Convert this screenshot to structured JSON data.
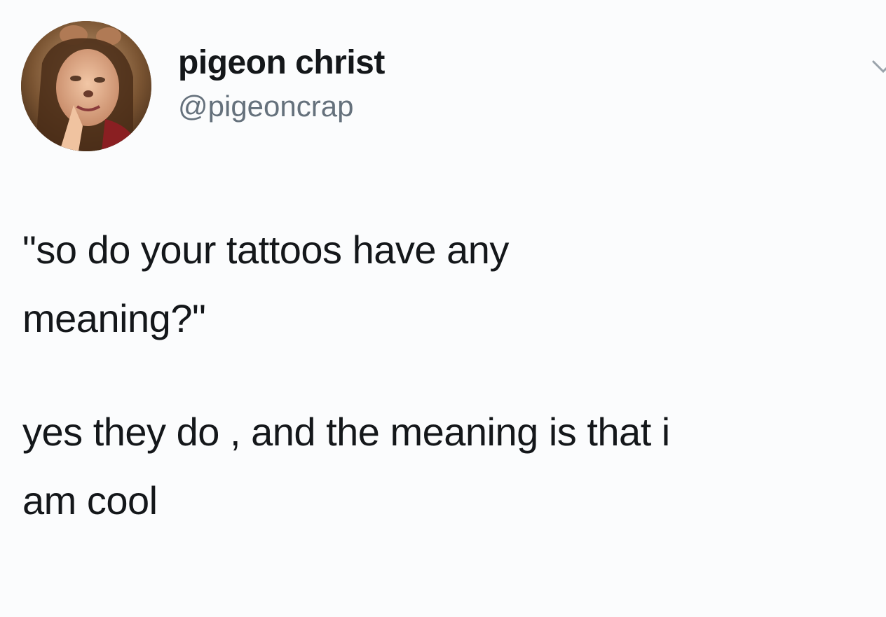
{
  "tweet": {
    "author": {
      "display_name": "pigeon christ",
      "handle": "@pigeoncrap"
    },
    "paragraphs": [
      "\"so do your tattoos have any\nmeaning?\"",
      "yes they do , and the meaning is that i\nam cool"
    ],
    "icons": {
      "avatar": "profile-photo",
      "menu": "chevron-down-icon"
    }
  }
}
